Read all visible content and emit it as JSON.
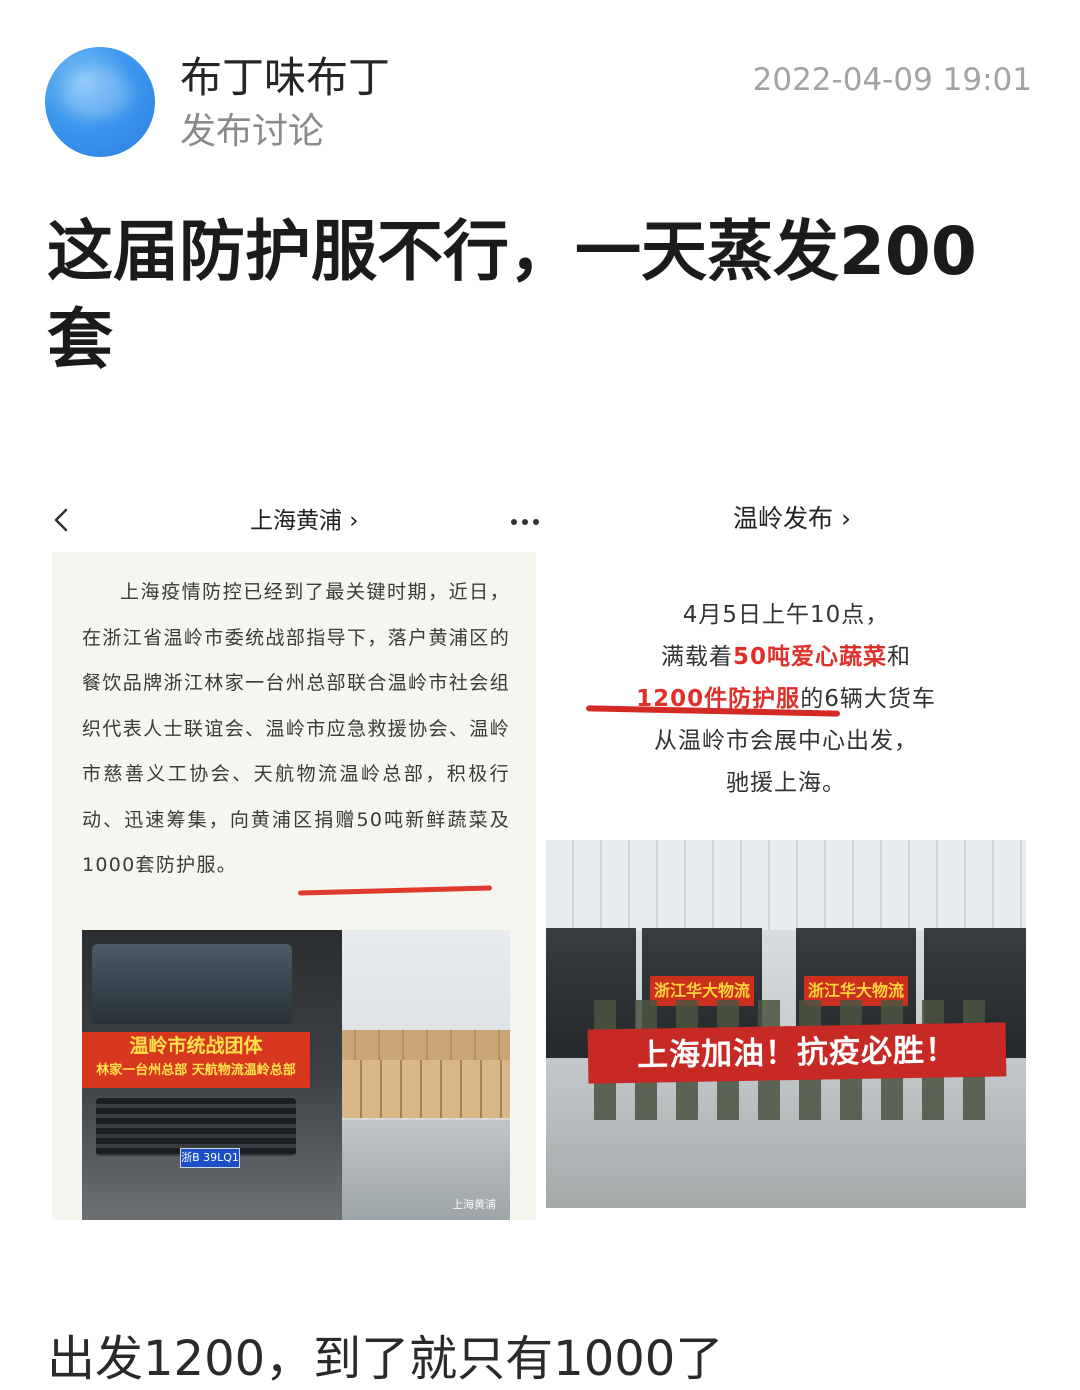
{
  "author": {
    "name": "布丁味布丁",
    "subtitle": "发布讨论",
    "timestamp": "2022-04-09 19:01"
  },
  "post": {
    "title": "这届防护服不行，一天蒸发200套",
    "body": "出发1200，到了就只有1000了"
  },
  "image": {
    "left_header": "上海黄浦 ›",
    "right_header": "温岭发布 ›",
    "left_article": "上海疫情防控已经到了最关键时期，近日，在浙江省温岭市委统战部指导下，落户黄浦区的餐饮品牌浙江林家一台州总部联合温岭市社会组织代表人士联谊会、温岭市应急救援协会、温岭市慈善义工协会、天航物流温岭总部，积极行动、迅速筹集，向黄浦区捐赠50吨新鲜蔬菜及1000套防护服。",
    "left_banner_line1": "温岭市统战团体",
    "left_banner_line2": "林家一台州总部  天航物流温岭总部",
    "plate": "浙B 39LQ1",
    "watermark": "上海黄浦",
    "quote": {
      "line1": "4月5日上午10点，",
      "line2_pre": "满载着",
      "line2_hl": "50吨爱心蔬菜",
      "line2_post": "和",
      "line3_hl": "1200件防护服",
      "line3_post": "的6辆大货车",
      "line4": "从温岭市会展中心出发，",
      "line5": "驰援上海。"
    },
    "cargo_label": "浙江华大物流",
    "right_banner": "上海加油！抗疫必胜！"
  },
  "colors": {
    "avatar": "#3c97ee",
    "highlight_red": "#e0302a",
    "banner_red": "#c72a24",
    "muted_text": "#8a8a8a"
  }
}
